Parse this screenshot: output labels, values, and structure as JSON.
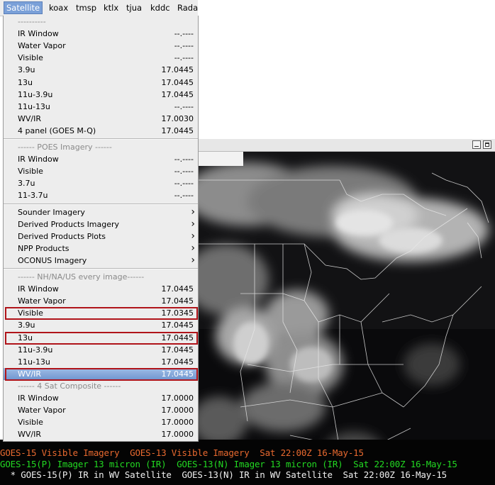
{
  "menubar": {
    "items": [
      "Satellite",
      "koax",
      "tmsp",
      "ktlx",
      "tjua",
      "kddc",
      "Rada"
    ],
    "active": "Satellite"
  },
  "menu": {
    "rows": [
      {
        "type": "header",
        "label": "----------"
      },
      {
        "type": "item",
        "label": "IR Window",
        "value": "--.----"
      },
      {
        "type": "item",
        "label": "Water Vapor",
        "value": "--.----"
      },
      {
        "type": "item",
        "label": "Visible",
        "value": "--.----"
      },
      {
        "type": "item",
        "label": "3.9u",
        "value": "17.0445"
      },
      {
        "type": "item",
        "label": "13u",
        "value": "17.0445"
      },
      {
        "type": "item",
        "label": "11u-3.9u",
        "value": "17.0445"
      },
      {
        "type": "item",
        "label": "11u-13u",
        "value": "--.----"
      },
      {
        "type": "item",
        "label": "WV/IR",
        "value": "17.0030"
      },
      {
        "type": "item",
        "label": "4 panel (GOES M-Q)",
        "value": "17.0445"
      },
      {
        "type": "sep"
      },
      {
        "type": "header",
        "label": "------ POES Imagery ------"
      },
      {
        "type": "item",
        "label": "IR Window",
        "value": "--.----"
      },
      {
        "type": "item",
        "label": "Visible",
        "value": "--.----"
      },
      {
        "type": "item",
        "label": "3.7u",
        "value": "--.----"
      },
      {
        "type": "item",
        "label": "11-3.7u",
        "value": "--.----"
      },
      {
        "type": "sep"
      },
      {
        "type": "submenu",
        "label": "Sounder Imagery"
      },
      {
        "type": "submenu",
        "label": "Derived Products Imagery"
      },
      {
        "type": "submenu",
        "label": "Derived Products Plots"
      },
      {
        "type": "submenu",
        "label": "NPP Products"
      },
      {
        "type": "submenu",
        "label": "OCONUS Imagery"
      },
      {
        "type": "sep"
      },
      {
        "type": "header",
        "label": "------ NH/NA/US every image------"
      },
      {
        "type": "item",
        "label": "IR Window",
        "value": "17.0445"
      },
      {
        "type": "item",
        "label": "Water Vapor",
        "value": "17.0445"
      },
      {
        "type": "item",
        "label": "Visible",
        "value": "17.0345",
        "boxed": true
      },
      {
        "type": "item",
        "label": "3.9u",
        "value": "17.0445"
      },
      {
        "type": "item",
        "label": "13u",
        "value": "17.0445",
        "boxed": true
      },
      {
        "type": "item",
        "label": "11u-3.9u",
        "value": "17.0445"
      },
      {
        "type": "item",
        "label": "11u-13u",
        "value": "17.0445"
      },
      {
        "type": "item",
        "label": "WV/IR",
        "value": "17.0445",
        "boxed": true,
        "highlighted": true
      },
      {
        "type": "header",
        "label": "------ 4 Sat Composite ------"
      },
      {
        "type": "item",
        "label": "IR Window",
        "value": "17.0000"
      },
      {
        "type": "item",
        "label": "Water Vapor",
        "value": "17.0000"
      },
      {
        "type": "item",
        "label": "Visible",
        "value": "17.0000"
      },
      {
        "type": "item",
        "label": "WV/IR",
        "value": "17.0000"
      }
    ]
  },
  "legend": {
    "line1": [
      {
        "text": "GOES-15 Visible Imagery  GOES-13 Visible Imagery  Sat 22:00Z 16-May-15",
        "color": "orange"
      }
    ],
    "line2": [
      {
        "text": "GOES-15(P) Imager 13 micron (IR)  GOES-13(N) Imager 13 micron (IR)  Sat 22:00Z 16-May-15",
        "color": "green"
      }
    ],
    "line3": [
      {
        "text": "  * GOES-15(P) IR in WV Satellite  GOES-13(N) IR in WV Satellite  Sat 22:00Z 16-May-15",
        "color": "white"
      }
    ]
  },
  "colors": {
    "accent_blue": "#7aa0d8",
    "highlight_box": "#b0141a",
    "legend_orange": "#e8692f",
    "legend_green": "#22d822",
    "legend_white": "#f0f0f0"
  }
}
